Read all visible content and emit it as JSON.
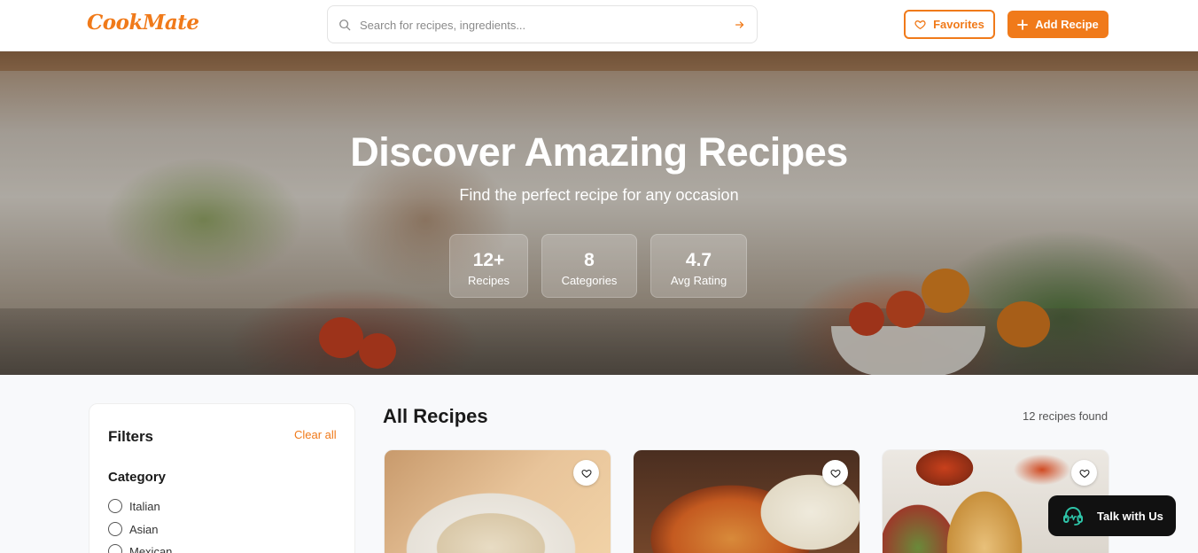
{
  "brand": {
    "name": "CookMate",
    "accent": "#f07a1a"
  },
  "search": {
    "placeholder": "Search for recipes, ingredients..."
  },
  "header": {
    "favorites_label": "Favorites",
    "add_recipe_label": "Add Recipe"
  },
  "hero": {
    "title": "Discover Amazing Recipes",
    "subtitle": "Find the perfect recipe for any occasion",
    "stats": [
      {
        "value": "12+",
        "label": "Recipes"
      },
      {
        "value": "8",
        "label": "Categories"
      },
      {
        "value": "4.7",
        "label": "Avg Rating"
      }
    ]
  },
  "filters": {
    "title": "Filters",
    "clear_label": "Clear all",
    "category_title": "Category",
    "options": [
      "Italian",
      "Asian",
      "Mexican"
    ]
  },
  "main": {
    "title": "All Recipes",
    "count_text": "12 recipes found",
    "cards": [
      {
        "icon": "heart-icon"
      },
      {
        "icon": "heart-icon"
      },
      {
        "icon": "heart-icon"
      }
    ]
  },
  "support": {
    "label": "Talk with Us",
    "icon": "headset-icon",
    "icon_color": "#2ec4a8"
  }
}
